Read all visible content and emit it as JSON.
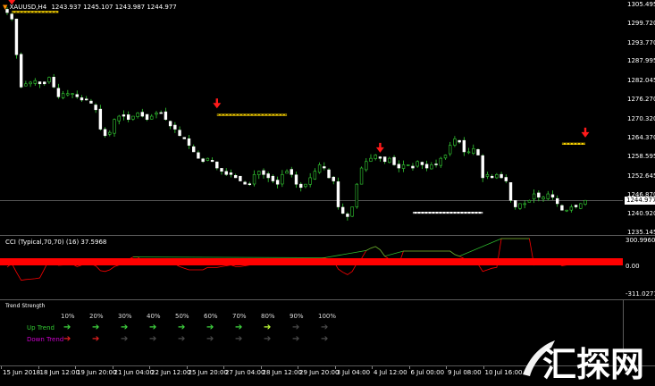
{
  "chart_header": {
    "symbol_label": "XAUUSD,H4",
    "ohlc_label": "1243.937 1245.107 1243.987 1244.977"
  },
  "price_scale": {
    "ticks": [
      "1305.495",
      "1299.720",
      "1293.770",
      "1287.995",
      "1282.045",
      "1276.270",
      "1270.320",
      "1264.370",
      "1258.595",
      "1252.645",
      "1246.870",
      "1240.920",
      "1235.145"
    ],
    "current_price": "1244.977"
  },
  "indicator": {
    "label": "CCI (Typical,70,70) (16) 37.5968",
    "scale_top": "300.9960",
    "scale_mid": "0.00",
    "scale_bottom": "-311.0271",
    "band_color": "#ff0000",
    "line_color": "#ff0000"
  },
  "trend_strength": {
    "title": "Trend Strength",
    "percent_labels": [
      "10%",
      "20%",
      "30%",
      "40%",
      "50%",
      "60%",
      "70%",
      "80%",
      "90%",
      "100%"
    ],
    "up_label": "Up Trend",
    "down_label": "Down Trend",
    "up_arrows": [
      "➔",
      "➔",
      "➔",
      "➔",
      "➔",
      "➔",
      "➔",
      "➔",
      "➔",
      "➔"
    ],
    "down_arrows": [
      "➔",
      "➔",
      "➔",
      "➔",
      "➔",
      "➔",
      "➔",
      "➔",
      "➔",
      "➔"
    ],
    "up_active_count": 8,
    "down_active_count": 2,
    "up_color": "#33cc33",
    "down_color": "#cc00cc"
  },
  "time_axis": {
    "ticks": [
      "15 Jun 2018",
      "18 Jun 12:00",
      "19 Jun 20:00",
      "21 Jun 04:00",
      "22 Jun 12:00",
      "25 Jun 20:00",
      "27 Jun 04:00",
      "28 Jun 12:00",
      "29 Jun 20:00",
      "3 Jul 04:00",
      "4 Jul 12:00",
      "6 Jul 00:00",
      "9 Jul 08:00",
      "10 Jul 16:00"
    ]
  },
  "watermark": {
    "text": "汇探网"
  },
  "chart_data": {
    "type": "candlestick",
    "price_range": [
      1235.145,
      1305.495
    ],
    "closes": [
      1303,
      1301,
      1290,
      1280,
      1281,
      1281.5,
      1282,
      1281,
      1281,
      1283,
      1280,
      1277,
      1278,
      1278,
      1278,
      1277,
      1276,
      1276,
      1275,
      1273,
      1267,
      1265,
      1266,
      1270,
      1271,
      1271,
      1270,
      1271,
      1272,
      1271,
      1270,
      1271,
      1272,
      1272,
      1270,
      1268,
      1267,
      1265,
      1264,
      1262,
      1260,
      1258,
      1257,
      1258,
      1257,
      1255,
      1254,
      1253,
      1253,
      1252,
      1251,
      1250,
      1250,
      1253,
      1254,
      1253,
      1252,
      1251,
      1250,
      1253,
      1254,
      1253,
      1250,
      1249,
      1250,
      1252,
      1254,
      1256,
      1255,
      1252,
      1251,
      1243,
      1241,
      1240,
      1243,
      1250,
      1255,
      1257,
      1258,
      1259,
      1258,
      1257,
      1258,
      1256,
      1255,
      1256,
      1256,
      1255,
      1257,
      1256,
      1255,
      1256,
      1256,
      1258,
      1259,
      1262,
      1264,
      1263,
      1260,
      1260,
      1261,
      1259,
      1252,
      1253,
      1252,
      1253,
      1252,
      1251,
      1245,
      1243,
      1244,
      1244,
      1245,
      1247,
      1246,
      1246,
      1247,
      1246,
      1244,
      1242,
      1242,
      1243,
      1243,
      1244,
      1245
    ],
    "sell_signals": [
      {
        "index": 1,
        "price": 1303.5
      },
      {
        "index": 45,
        "price": 1271.5
      },
      {
        "index": 80,
        "price": 1257.8
      },
      {
        "index": 128,
        "price": 1262.5
      }
    ],
    "cci_range": [
      -311.0271,
      300.996
    ]
  }
}
